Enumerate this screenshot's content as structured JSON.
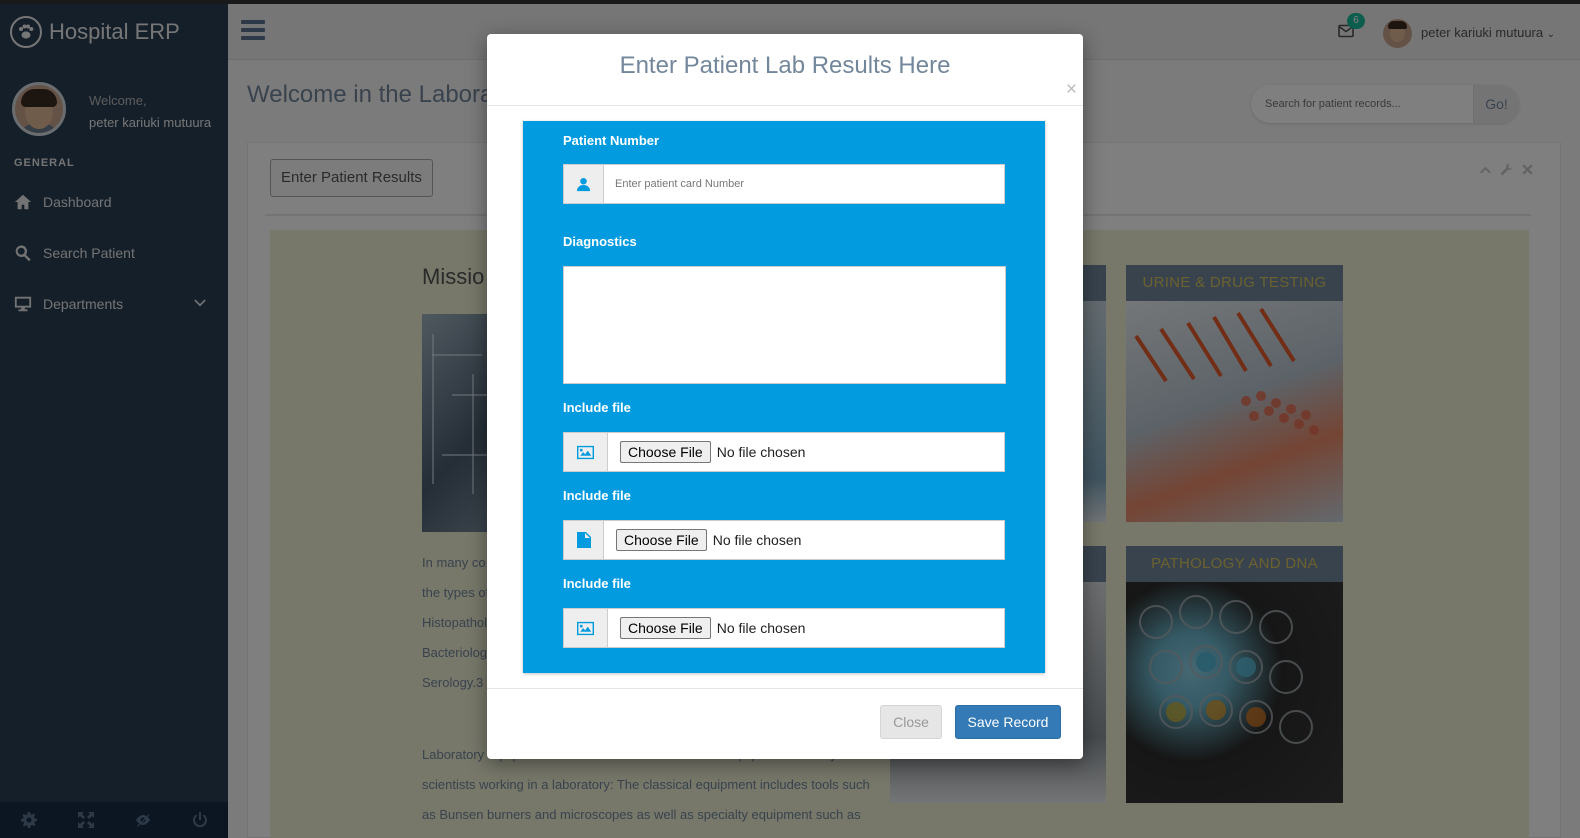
{
  "app": {
    "title": "Hospital ERP"
  },
  "sidebar": {
    "welcome": "Welcome,",
    "user_name": "peter kariuki mutuura",
    "section_title": "GENERAL",
    "items": [
      {
        "label": "Dashboard",
        "icon": "home-icon"
      },
      {
        "label": "Search Patient",
        "icon": "search-icon"
      },
      {
        "label": "Departments",
        "icon": "desktop-icon"
      }
    ],
    "footer_icons": [
      "settings-icon",
      "fullscreen-icon",
      "lock-icon",
      "logout-icon"
    ]
  },
  "topbar": {
    "mail_count": "6",
    "user_name": "peter kariuki mutuura"
  },
  "main": {
    "page_title": "Welcome in the Labora",
    "search": {
      "placeholder": "Search for patient records...",
      "button": "Go!"
    },
    "panel_button": "Enter Patient Results",
    "mission_title": "Missio",
    "text_lines": [
      "In many co",
      "the types of",
      "Histopathol",
      "Bacteriolog",
      "Serology.3"
    ],
    "text2": "Laboratory equipment refers to the various tools and equipment used by scientists working in a laboratory: The classical equipment includes tools such as Bunsen burners and microscopes as well as specialty equipment such as",
    "cards": [
      {
        "title": "URINE & DRUG TESTING"
      },
      {
        "title": "PATHOLOGY AND DNA"
      }
    ]
  },
  "modal": {
    "title": "Enter Patient Lab Results Here",
    "close_symbol": "×",
    "patient_label": "Patient Number",
    "patient_placeholder": "Enter patient card Number",
    "diagnostics_label": "Diagnostics",
    "file_fields": [
      {
        "label": "Include file",
        "icon": "image-icon",
        "button": "Choose File",
        "status": "No file chosen"
      },
      {
        "label": "Include file",
        "icon": "file-icon",
        "button": "Choose File",
        "status": "No file chosen"
      },
      {
        "label": "Include file",
        "icon": "image-icon",
        "button": "Choose File",
        "status": "No file chosen"
      }
    ],
    "close_button": "Close",
    "save_button": "Save Record"
  }
}
